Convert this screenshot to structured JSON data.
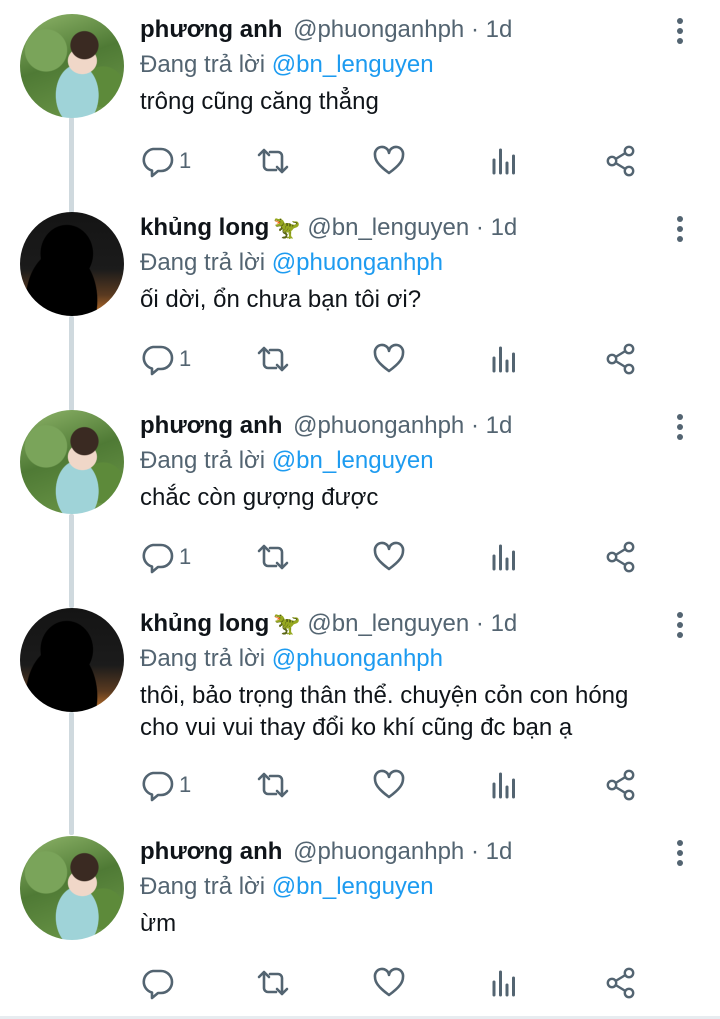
{
  "tweets": [
    {
      "name": "phương anh",
      "emoji": "",
      "handle": "@phuonganhph",
      "dot": "·",
      "time": "1d",
      "reply_prefix": "Đang trả lời",
      "reply_to": "@bn_lenguyen",
      "text_lines": [
        "trông cũng căng thẳng"
      ],
      "reply_count": "1"
    },
    {
      "name": "khủng long",
      "emoji": "🦖",
      "handle": "@bn_lenguyen",
      "dot": "·",
      "time": "1d",
      "reply_prefix": "Đang trả lời",
      "reply_to": "@phuonganhph",
      "text_lines": [
        "ối dời, ổn chưa bạn tôi ơi?"
      ],
      "reply_count": "1"
    },
    {
      "name": "phương anh",
      "emoji": "",
      "handle": "@phuonganhph",
      "dot": "·",
      "time": "1d",
      "reply_prefix": "Đang trả lời",
      "reply_to": "@bn_lenguyen",
      "text_lines": [
        "chắc còn gượng được"
      ],
      "reply_count": "1"
    },
    {
      "name": "khủng long",
      "emoji": "🦖",
      "handle": "@bn_lenguyen",
      "dot": "·",
      "time": "1d",
      "reply_prefix": "Đang trả lời",
      "reply_to": "@phuonganhph",
      "text_lines": [
        "thôi, bảo trọng thân thể. chuyện cỏn con hóng",
        "cho vui vui thay đổi ko khí cũng đc bạn ạ"
      ],
      "reply_count": "1"
    },
    {
      "name": "phương anh",
      "emoji": "",
      "handle": "@phuonganhph",
      "dot": "·",
      "time": "1d",
      "reply_prefix": "Đang trả lời",
      "reply_to": "@bn_lenguyen",
      "text_lines": [
        "ừm"
      ],
      "reply_count": ""
    }
  ],
  "icons": {
    "reply": "reply-icon",
    "retweet": "retweet-icon",
    "like": "heart-icon",
    "views": "analytics-icon",
    "share": "share-icon",
    "more": "more-vertical-icon"
  },
  "colors": {
    "text": "#0f1419",
    "secondary": "#536471",
    "mention": "#1d9bf0",
    "thread_line": "#cfd9de"
  }
}
